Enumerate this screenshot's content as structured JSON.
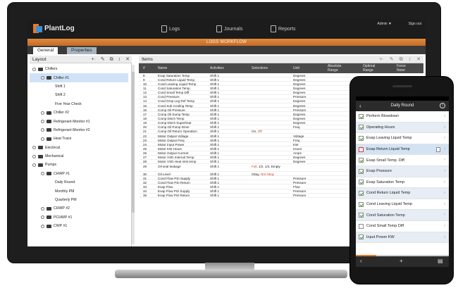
{
  "app": {
    "logo_text": "PlantLog",
    "nav": [
      "Logs",
      "Journals",
      "Reports"
    ],
    "admin": "Admin ▼",
    "signout": "Sign out",
    "workflow": "LOGS WORKFLOW",
    "subtabs": [
      "General",
      "Properties"
    ]
  },
  "layout": {
    "title": "Layout",
    "tools": [
      "+·",
      "✎",
      "⧉",
      "↕",
      "✕"
    ],
    "tree": [
      {
        "label": "Chillers",
        "level": 0,
        "type": "folder"
      },
      {
        "label": "Chiller #1",
        "level": 1,
        "type": "folder",
        "selected": true
      },
      {
        "label": "Shift 1",
        "level": 2,
        "type": "item"
      },
      {
        "label": "Shift 2",
        "level": 2,
        "type": "item"
      },
      {
        "label": "Five Year Check",
        "level": 2,
        "type": "item"
      },
      {
        "label": "Chiller #2",
        "level": 1,
        "type": "folder"
      },
      {
        "label": "Refrigerant Monitor #1",
        "level": 1,
        "type": "folder"
      },
      {
        "label": "Refrigerant Monitor #2",
        "level": 1,
        "type": "folder"
      },
      {
        "label": "Heat Trace",
        "level": 1,
        "type": "folder"
      },
      {
        "label": "Electrical",
        "level": 0,
        "type": "folder"
      },
      {
        "label": "Mechanical",
        "level": 0,
        "type": "folder"
      },
      {
        "label": "Pumps",
        "level": 0,
        "type": "folder"
      },
      {
        "label": "CHWP #1",
        "level": 1,
        "type": "folder"
      },
      {
        "label": "Daily Round",
        "level": 2,
        "type": "item"
      },
      {
        "label": "Monthly PM",
        "level": 2,
        "type": "item"
      },
      {
        "label": "Quarterly PM",
        "level": 2,
        "type": "item"
      },
      {
        "label": "CHWP #2",
        "level": 1,
        "type": "folder"
      },
      {
        "label": "PCHWP #1",
        "level": 1,
        "type": "folder"
      },
      {
        "label": "CWP #1",
        "level": 1,
        "type": "folder"
      }
    ]
  },
  "items": {
    "title": "Items",
    "tools": [
      "+·",
      "✎",
      "⧉",
      "↕",
      "✕"
    ],
    "columns": [
      "#",
      "Name",
      "Activities",
      "Selections",
      "Unit",
      "Absolute Range",
      "Optimal Range",
      "Force None"
    ],
    "rows": [
      {
        "n": "8",
        "name": "Evap Saturation Temp",
        "act": "Shift 1",
        "sel": "",
        "unit": "Degrees"
      },
      {
        "n": "9",
        "name": "Cond Return Liquid Temp",
        "act": "Shift 1",
        "sel": "",
        "unit": "Degrees"
      },
      {
        "n": "10",
        "name": "Cond Leaving Liquid Temp",
        "act": "Shift 1",
        "sel": "",
        "unit": "Degrees"
      },
      {
        "n": "11",
        "name": "Cond Saturation Temp",
        "act": "Shift 1",
        "sel": "",
        "unit": "Degrees"
      },
      {
        "n": "12",
        "name": "Cond Small Temp Diff",
        "act": "Shift 1",
        "sel": "",
        "unit": "Degrees"
      },
      {
        "n": "13",
        "name": "Cond Pressure",
        "act": "Shift 1",
        "sel": "",
        "unit": "Pressure"
      },
      {
        "n": "14",
        "name": "Cond Drop Leg Ref Temp",
        "act": "Shift 1",
        "sel": "",
        "unit": "Degrees"
      },
      {
        "n": "15",
        "name": "Cond Sub Cooling Temp",
        "act": "Shift 1",
        "sel": "",
        "unit": "Degrees"
      },
      {
        "n": "16",
        "name": "Comp Oil Pressure",
        "act": "Shift 1",
        "sel": "",
        "unit": "Pressure"
      },
      {
        "n": "17",
        "name": "Comp Oil Sump Temp",
        "act": "Shift 1",
        "sel": "",
        "unit": "Degrees"
      },
      {
        "n": "18",
        "name": "Comp Disch Temp",
        "act": "Shift 1",
        "sel": "",
        "unit": "Degrees"
      },
      {
        "n": "19",
        "name": "Comp Disch Superheat",
        "act": "Shift 1",
        "sel": "",
        "unit": "Degrees"
      },
      {
        "n": "20",
        "name": "Comp Oil Pump Drive",
        "act": "Shift 1",
        "sel": "",
        "unit": "Freq"
      },
      {
        "n": "21",
        "name": "Comp Oil Return Operation",
        "act": "Shift 1",
        "sel": "On, ",
        "sel_red": "Off",
        "unit": ""
      },
      {
        "n": "22",
        "name": "Motor Output Voltage",
        "act": "Shift 1",
        "sel": "",
        "unit": "Voltage"
      },
      {
        "n": "23",
        "name": "Motor Output Freq",
        "act": "Shift 1",
        "sel": "",
        "unit": "Freq"
      },
      {
        "n": "24",
        "name": "Motor Input Power",
        "act": "Shift 1",
        "sel": "",
        "unit": "KW"
      },
      {
        "n": "25",
        "name": "Motor KW Hours",
        "act": "Shift 1",
        "sel": "",
        "unit": "Hours"
      },
      {
        "n": "26",
        "name": "Motor Output Current",
        "act": "Shift 1",
        "sel": "",
        "unit": "Amps"
      },
      {
        "n": "27",
        "name": "Motor VSD Internal Temp",
        "act": "Shift 1",
        "sel": "",
        "unit": "Degrees"
      },
      {
        "n": "28",
        "name": "Motor VSD Heat sink temp",
        "act": "Shift 1",
        "sel": "",
        "unit": "Degrees"
      },
      {
        "n": "29",
        "name": "Oil seal leakage",
        "act": "Shift 1",
        "sel_red": "Full",
        "sel": ", 1/2, 1/4, Empty",
        "unit": "",
        "tall": true
      },
      {
        "n": "30",
        "name": "Oil Level",
        "act": "Shift 1",
        "sel": "Okay, ",
        "sel_red": "Not Okay",
        "unit": ""
      },
      {
        "n": "31",
        "name": "Cond Flow PSI Supply",
        "act": "Shift 1",
        "sel": "",
        "unit": "Pressure"
      },
      {
        "n": "32",
        "name": "Cond Flow PSI Return",
        "act": "Shift 1",
        "sel": "",
        "unit": "Pressure"
      },
      {
        "n": "33",
        "name": "Evap Flow",
        "act": "Shift 1",
        "sel": "",
        "unit": "Flow"
      },
      {
        "n": "34",
        "name": "Evap Flow PSI Supply",
        "act": "Shift 1",
        "sel": "",
        "unit": "Pressure"
      },
      {
        "n": "35",
        "name": "Evap Flow PSI Return",
        "act": "Shift 1",
        "sel": "",
        "unit": "Pressure"
      }
    ]
  },
  "phone": {
    "title": "Daily Round",
    "progress": 0.22,
    "items": [
      {
        "label": "Perform Blowdown",
        "state": "on"
      },
      {
        "label": "Operating Hours",
        "state": "on"
      },
      {
        "label": "Evap Leaving Liquid Temp",
        "state": "on"
      },
      {
        "label": "Evap Return Liquid Temp",
        "state": "warn",
        "note": true
      },
      {
        "label": "Evap Small Temp. Diff",
        "state": "on"
      },
      {
        "label": "Evap Pressure",
        "state": "on"
      },
      {
        "label": "Evap Saturation Temp",
        "state": "on"
      },
      {
        "label": "Cond Return Liquid Temp",
        "state": "on"
      },
      {
        "label": "Cond Leaving Liquid Temp",
        "state": "on"
      },
      {
        "label": "Cond Saturation Temp",
        "state": "on"
      },
      {
        "label": "Cond Small Temp Diff",
        "state": "off"
      },
      {
        "label": "Input Power KW",
        "state": "on"
      }
    ],
    "bar": [
      "‹",
      "+",
      "▤"
    ]
  },
  "colors": {
    "accent": "#e8792a",
    "logo_blue": "#3f8fd6",
    "nav_bg": "#1c1c1c",
    "selected": "#cfe2f7",
    "alert": "#d9392c",
    "check": "#3a9d3a"
  }
}
